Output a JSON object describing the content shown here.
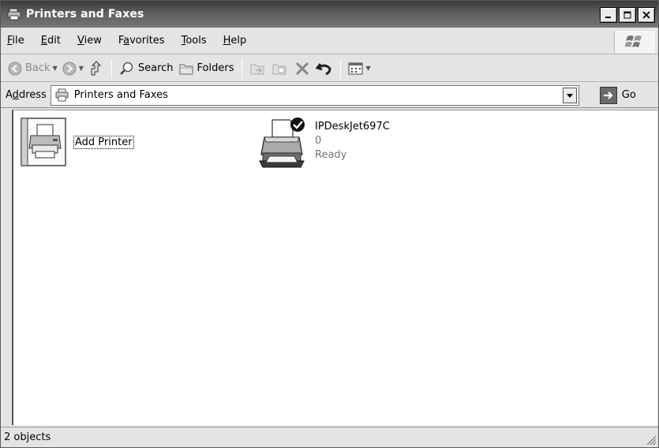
{
  "window": {
    "title": "Printers and Faxes"
  },
  "menubar": {
    "items": [
      {
        "label_pre": "",
        "label_key": "F",
        "label_post": "ile"
      },
      {
        "label_pre": "",
        "label_key": "E",
        "label_post": "dit"
      },
      {
        "label_pre": "",
        "label_key": "V",
        "label_post": "iew"
      },
      {
        "label_pre": "F",
        "label_key": "a",
        "label_post": "vorites"
      },
      {
        "label_pre": "",
        "label_key": "T",
        "label_post": "ools"
      },
      {
        "label_pre": "",
        "label_key": "H",
        "label_post": "elp"
      }
    ]
  },
  "toolbar": {
    "back_label": "Back",
    "search_label": "Search",
    "folders_label": "Folders"
  },
  "address": {
    "label_pre": "A",
    "label_key": "d",
    "label_post": "dress",
    "value": "Printers and Faxes",
    "go_label": "Go"
  },
  "items": [
    {
      "name": "Add Printer",
      "icon": "add-printer-icon"
    },
    {
      "name": "IPDeskJet697C",
      "documents": "0",
      "status": "Ready",
      "icon": "printer-icon",
      "default": true
    }
  ],
  "statusbar": {
    "text": "2 objects"
  }
}
